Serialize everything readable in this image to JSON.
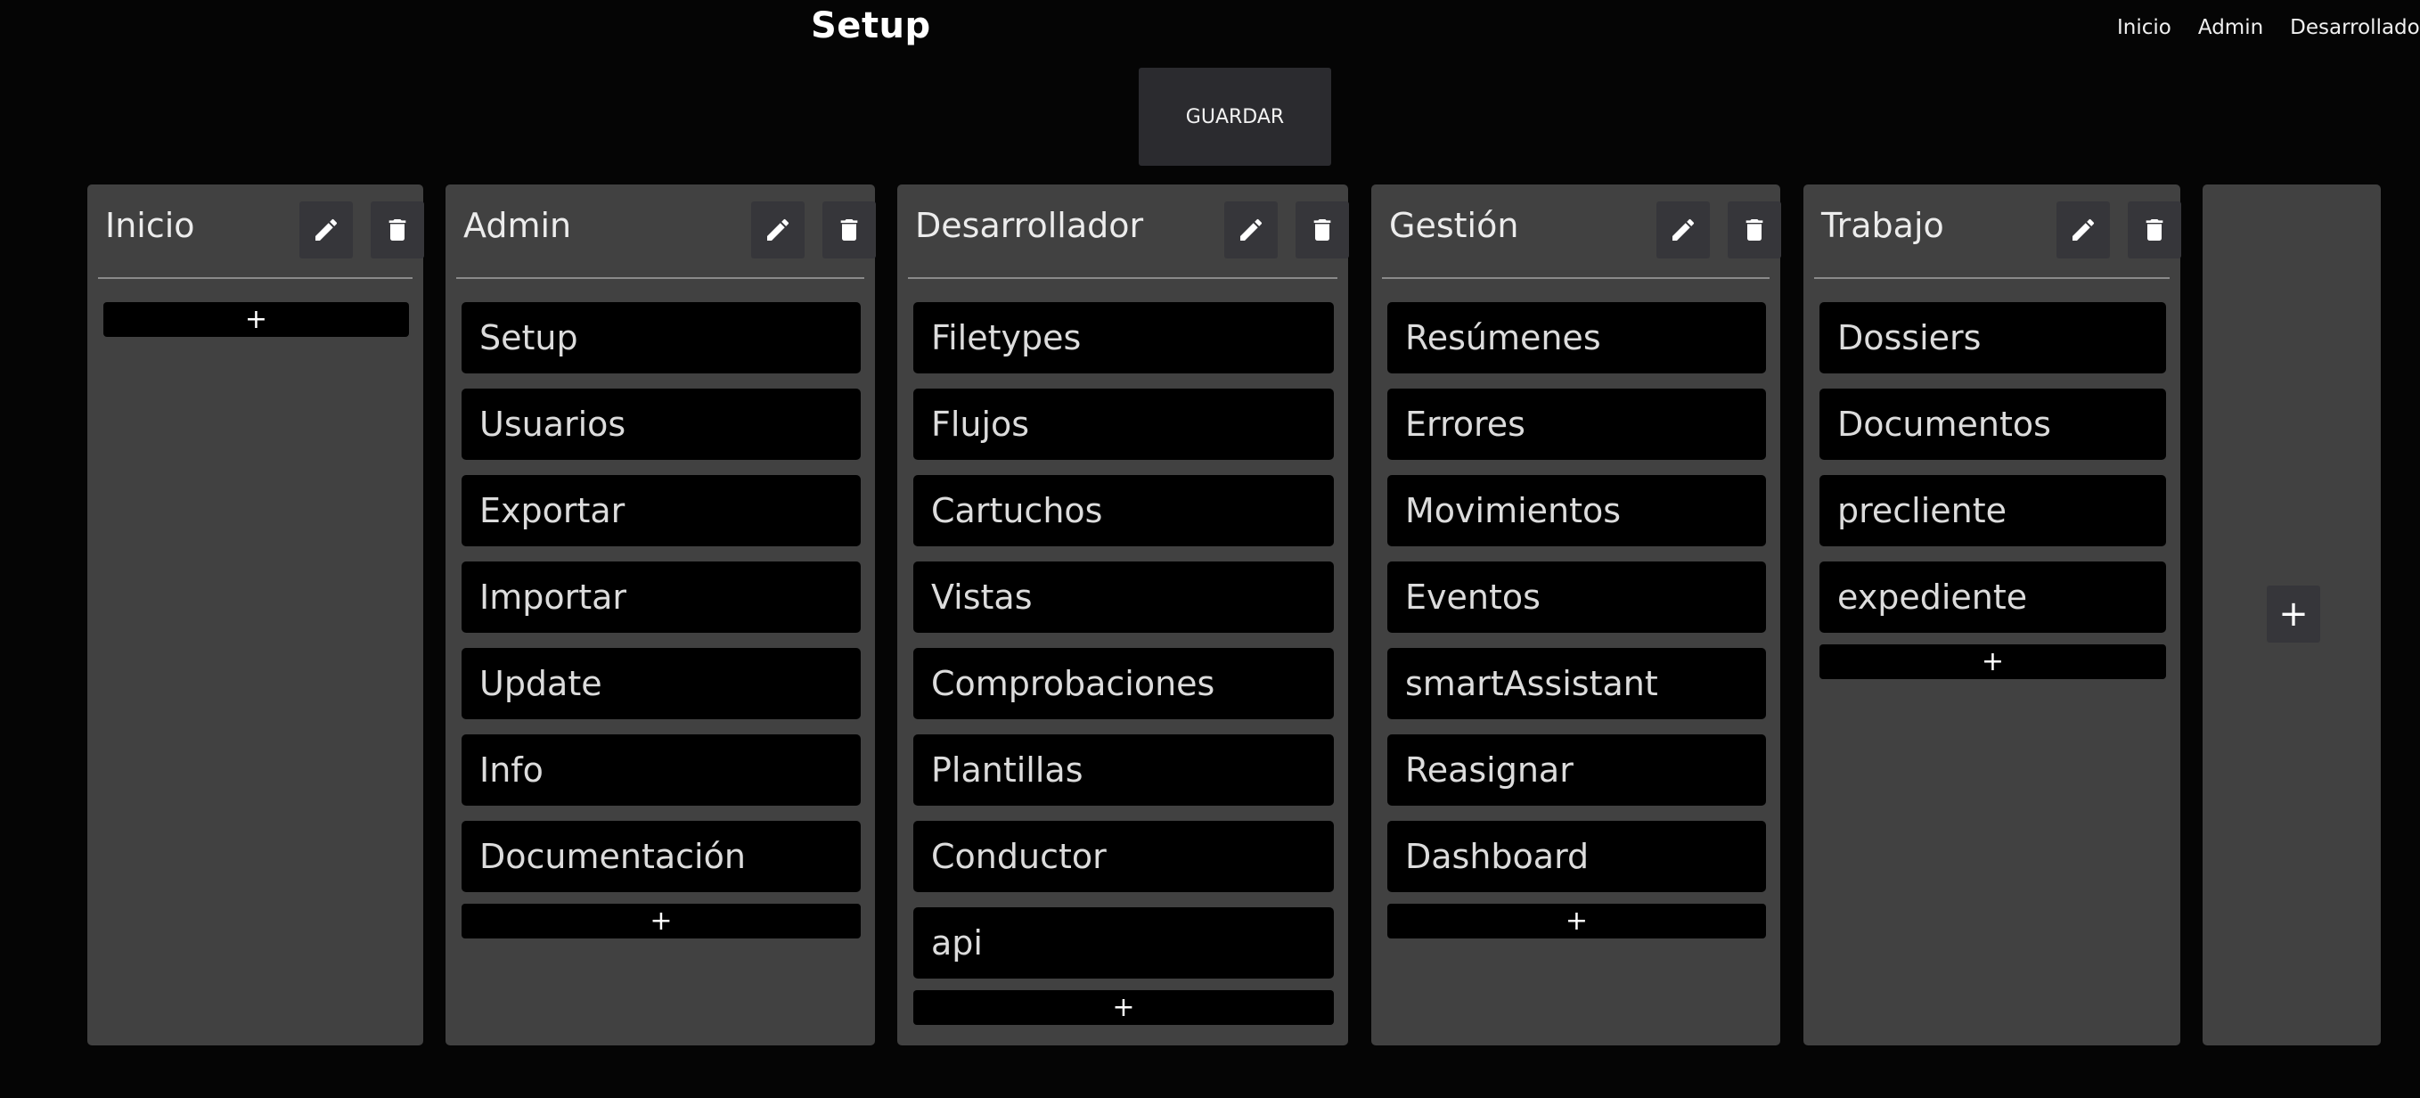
{
  "page_title": "Setup",
  "top_nav": [
    "Inicio",
    "Admin",
    "Desarrollador"
  ],
  "save_label": "GUARDAR",
  "add_symbol": "+",
  "icons": {
    "edit": "pencil-icon",
    "delete": "trash-icon"
  },
  "columns": [
    {
      "title": "Inicio",
      "items": []
    },
    {
      "title": "Admin",
      "items": [
        "Setup",
        "Usuarios",
        "Exportar",
        "Importar",
        "Update",
        "Info",
        "Documentación"
      ]
    },
    {
      "title": "Desarrollador",
      "items": [
        "Filetypes",
        "Flujos",
        "Cartuchos",
        "Vistas",
        "Comprobaciones",
        "Plantillas",
        "Conductor",
        "api"
      ]
    },
    {
      "title": "Gestión",
      "items": [
        "Resúmenes",
        "Errores",
        "Movimientos",
        "Eventos",
        "smartAssistant",
        "Reasignar",
        "Dashboard"
      ]
    },
    {
      "title": "Trabajo",
      "items": [
        "Dossiers",
        "Documentos",
        "precliente",
        "expediente"
      ]
    }
  ]
}
